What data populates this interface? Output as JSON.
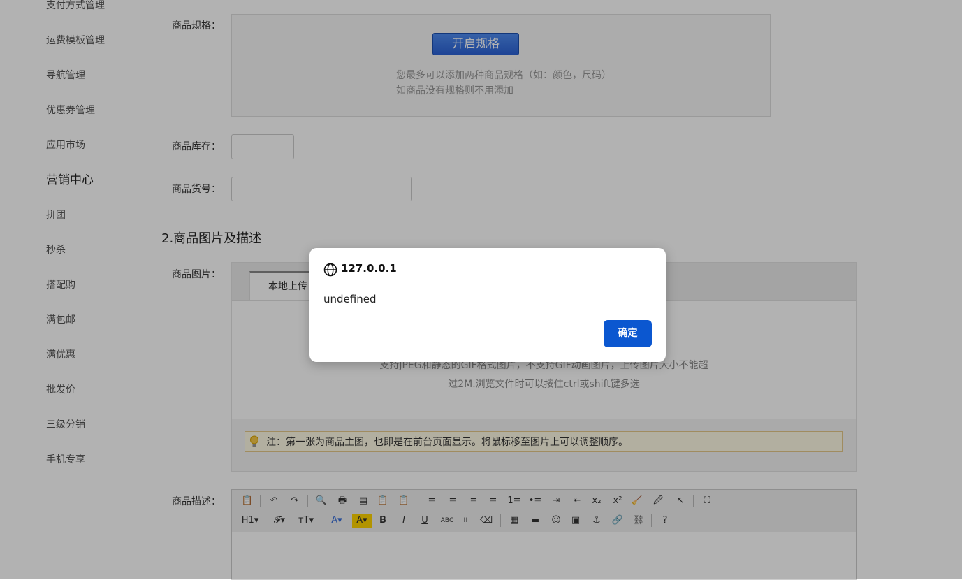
{
  "sidebar": {
    "items": [
      "支付方式管理",
      "运费模板管理",
      "导航管理",
      "优惠券管理",
      "应用市场"
    ],
    "section": "营销中心",
    "sub_items": [
      "拼团",
      "秒杀",
      "搭配购",
      "满包邮",
      "满优惠",
      "批发价",
      "三级分销",
      "手机专享"
    ]
  },
  "form": {
    "spec_label": "商品规格：",
    "spec_button": "开启规格",
    "spec_tip": "您最多可以添加两种商品规格（如：颜色，尺码）如商品没有规格则不用添加",
    "stock_label": "商品库存：",
    "sku_label": "商品货号：",
    "section_title": "2.商品图片及描述",
    "images_label": "商品图片：",
    "upload_tab": "本地上传",
    "upload_hint_1": "支持JPEG和静态的GIF格式图片，不支持GIF动画图片，上传图片大小不能超",
    "upload_hint_2": "过2M.浏览文件时可以按住ctrl或shift键多选",
    "note": "注：第一张为商品主图，也即是在前台页面显示。将鼠标移至图片上可以调整顺序。",
    "desc_label": "商品描述："
  },
  "editor": {
    "row1": [
      "📋",
      "↶",
      "↷",
      "🔍",
      "🖶",
      "▤",
      "📋",
      "📋",
      "≡",
      "≡",
      "≡",
      "≡",
      "1≡",
      "•≡",
      "⇥",
      "⇤",
      "x₂",
      "x²",
      "🧹",
      "🖉",
      "↖",
      "⛶"
    ],
    "row2": [
      "H1▾",
      "𝓕▾",
      "тT▾",
      "A▾",
      "A▾",
      "B",
      "I",
      "U",
      "ABC",
      "⌗",
      "⌫",
      "▦",
      "▬",
      "☺",
      "▣",
      "⚓",
      "🔗",
      "⛓",
      "?"
    ]
  },
  "dialog": {
    "origin": "127.0.0.1",
    "message": "undefined",
    "ok_label": "确定"
  },
  "colors": {
    "accent": "#0b57d0",
    "overlay": "rgba(0,0,0,0.3)"
  }
}
